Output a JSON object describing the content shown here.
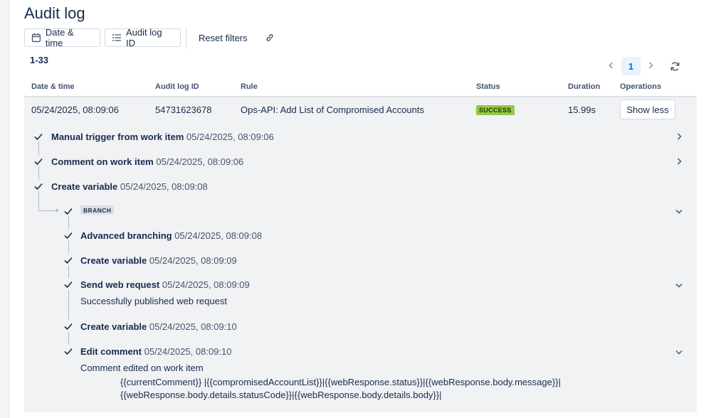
{
  "page": {
    "title": "Audit log"
  },
  "filters": {
    "date_time_label": "Date & time",
    "audit_log_id_label": "Audit log ID",
    "reset_label": "Reset filters"
  },
  "results": {
    "count_text": "1-33"
  },
  "pagination": {
    "current_page": "1"
  },
  "table": {
    "headers": [
      "Date & time",
      "Audit log ID",
      "Rule",
      "Status",
      "Duration",
      "Operations"
    ],
    "row": {
      "datetime": "05/24/2025, 08:09:06",
      "id": "54731623678",
      "rule": "Ops-API: Add List of Compromised Accounts",
      "status": "SUCCESS",
      "duration": "15.99s",
      "action_label": "Show less"
    }
  },
  "colors": {
    "success": "#94c748",
    "accent": "#0c66e4"
  },
  "steps": [
    {
      "title": "Manual trigger from work item",
      "time": "05/24/2025, 08:09:06"
    },
    {
      "title": "Comment on work item",
      "time": "05/24/2025, 08:09:06"
    },
    {
      "title": "Create variable",
      "time": "05/24/2025, 08:09:08"
    },
    {
      "badge": "BRANCH"
    },
    {
      "title": "Advanced branching",
      "time": "05/24/2025, 08:09:08"
    },
    {
      "title": "Create variable",
      "time": "05/24/2025, 08:09:09"
    },
    {
      "title": "Send web request",
      "time": "05/24/2025, 08:09:09",
      "detail": "Successfully published web request"
    },
    {
      "title": "Create variable",
      "time": "05/24/2025, 08:09:10"
    },
    {
      "title": "Edit comment",
      "time": "05/24/2025, 08:09:10",
      "detail": "Comment edited on work item",
      "code_lines": [
        "{{currentComment}} |{{compromisedAccountList}}|{{webResponse.status}}|{{webResponse.body.message}}|",
        "{{webResponse.body.details.statusCode}}|{{webResponse.body.details.body}}|"
      ]
    }
  ]
}
